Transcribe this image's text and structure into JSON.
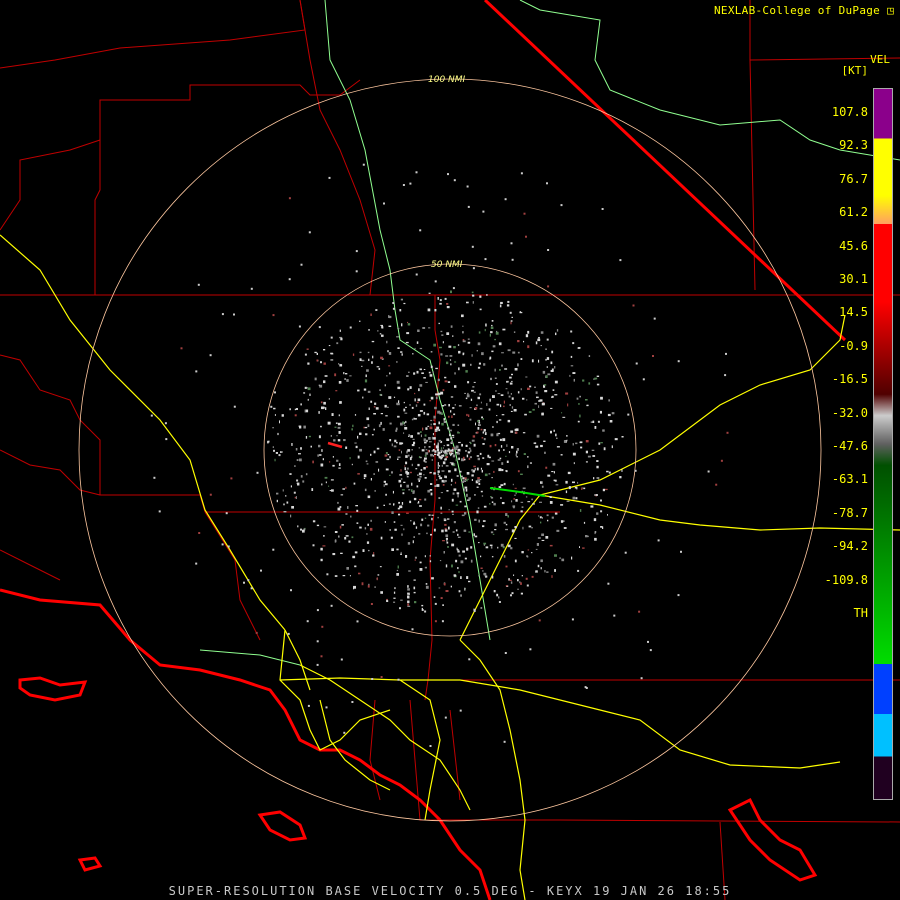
{
  "header": {
    "credit": "NEXLAB-College of DuPage"
  },
  "footer": {
    "product_line": "SUPER-RESOLUTION BASE VELOCITY 0.5 DEG - KEYX 19 JAN 26 18:55"
  },
  "range_rings": [
    {
      "label": "100 NMI"
    },
    {
      "label": "50 NMI"
    }
  ],
  "legend": {
    "title": "VEL",
    "unit": "[KT]",
    "ticks": [
      "107.8",
      "92.3",
      "76.7",
      "61.2",
      "45.6",
      "30.1",
      "14.5",
      "-0.9",
      "-16.5",
      "-32.0",
      "-47.6",
      "-63.1",
      "-78.7",
      "-94.2",
      "-109.8",
      "TH"
    ],
    "colors": {
      "purple": "#8b008b",
      "yellow": "#ffff00",
      "orange": "#ffa060",
      "red": "#ff0000",
      "dark_red": "#500000",
      "gray": "#cccccc",
      "dark_green": "#005000",
      "green": "#00dd00",
      "blue": "#0040ff",
      "cyan": "#00c0ff",
      "black": "#200020"
    }
  },
  "map_colors": {
    "state_border": "#ff0000",
    "county": "#c00000",
    "highway": "#ffff00",
    "river": "#90ff90",
    "ring": "#ffc8a0"
  }
}
